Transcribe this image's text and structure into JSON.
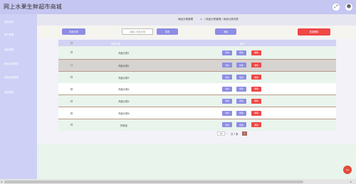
{
  "app": {
    "title": "网上水果生鲜超市商城",
    "header_icons": [
      "expand-icon",
      "user-icon"
    ]
  },
  "sidebar": {
    "items": [
      {
        "label": "系统首页"
      },
      {
        "label": "用户管理"
      },
      {
        "label": "商家管理"
      },
      {
        "label": "商品分类管理"
      },
      {
        "label": "商品信息管理"
      },
      {
        "label": "系统管理"
      }
    ]
  },
  "breadcrumb": {
    "title": "商品分类管理",
    "home_icon": "⌂",
    "path": "/ 商品分类管理 / 商品分类列表"
  },
  "toolbar": {
    "category_label": "商品分类",
    "search_placeholder": "请输入商品分类",
    "search_label": "查询",
    "add_label": "添加",
    "batch_delete_label": "批量删除"
  },
  "table": {
    "headers": {
      "name": "商品分类",
      "actions": "操作"
    },
    "rows": [
      {
        "name": "商品分类1"
      },
      {
        "name": "商品分类2"
      },
      {
        "name": "商品分类3"
      },
      {
        "name": "商品分类4"
      },
      {
        "name": "商品分类5"
      },
      {
        "name": "商品分类6"
      },
      {
        "name": "护肤品"
      }
    ],
    "row_actions": {
      "view": "查看",
      "edit": "修改",
      "delete": "删除"
    }
  },
  "pager": {
    "page_size": "10",
    "prev": "‹",
    "total": "共 7 条",
    "current_page": "1"
  },
  "back_to_top": {
    "label": "top"
  },
  "colors": {
    "primary": "#8d8de5",
    "danger": "#f04747",
    "header_bg": "#c6c6f2",
    "page_active": "#a86a5e"
  }
}
